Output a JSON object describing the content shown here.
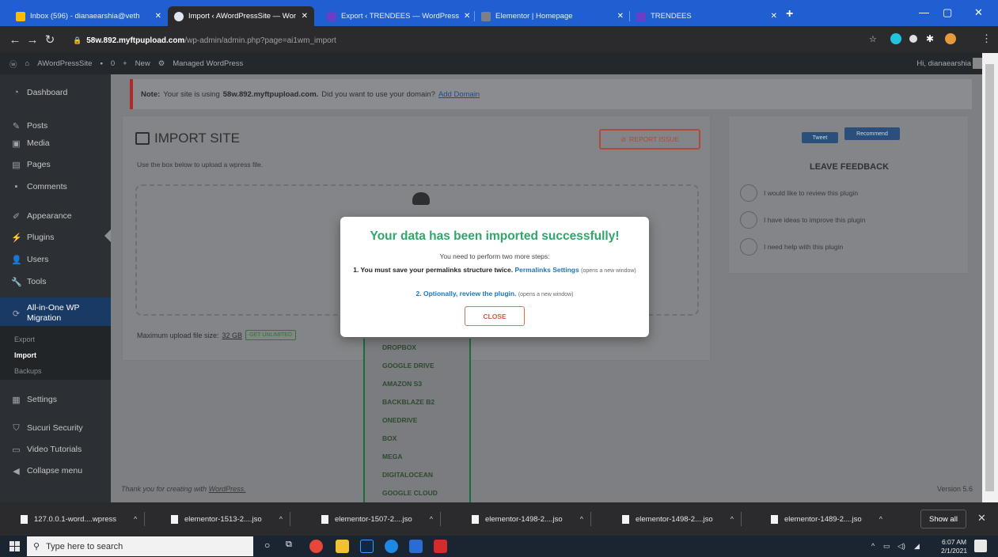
{
  "browser": {
    "tabs": [
      {
        "label": "Inbox (596) - dianaearshia@veth",
        "active": false
      },
      {
        "label": "Import ‹ AWordPressSite — Wor",
        "active": true
      },
      {
        "label": "Export ‹ TRENDEES — WordPress",
        "active": false
      },
      {
        "label": "Elementor | Homepage",
        "active": false
      },
      {
        "label": "TRENDEES",
        "active": false
      }
    ],
    "url_host": "58w.892.myftpupload.com",
    "url_path": "/wp-admin/admin.php?page=ai1wm_import"
  },
  "wp_admin_bar": {
    "site_name": "AWordPressSite",
    "comments_count": "0",
    "new_label": "New",
    "managed_label": "Managed WordPress",
    "greeting": "Hi, dianaearshia"
  },
  "sidebar": {
    "items": [
      {
        "label": "Dashboard",
        "icon": "dashboard-icon"
      },
      {
        "label": "Posts",
        "icon": "pin-icon"
      },
      {
        "label": "Media",
        "icon": "media-icon"
      },
      {
        "label": "Pages",
        "icon": "page-icon"
      },
      {
        "label": "Comments",
        "icon": "comment-icon"
      },
      {
        "label": "Appearance",
        "icon": "brush-icon"
      },
      {
        "label": "Plugins",
        "icon": "plug-icon"
      },
      {
        "label": "Users",
        "icon": "user-icon"
      },
      {
        "label": "Tools",
        "icon": "wrench-icon"
      },
      {
        "label": "All-in-One WP Migration",
        "icon": "migration-icon"
      },
      {
        "label": "Settings",
        "icon": "settings-icon"
      },
      {
        "label": "Sucuri Security",
        "icon": "shield-icon"
      },
      {
        "label": "Video Tutorials",
        "icon": "video-icon"
      },
      {
        "label": "Collapse menu",
        "icon": "collapse-icon"
      }
    ],
    "sub_items": [
      "Export",
      "Import",
      "Backups"
    ]
  },
  "notice": {
    "prefix": "Note:",
    "text": "Your site is using",
    "domain": "58w.892.myftpupload.com.",
    "question": "Did you want to use your domain?",
    "link": "Add Domain"
  },
  "import_panel": {
    "title": "IMPORT SITE",
    "report_label": "REPORT ISSUE",
    "description": "Use the box below to upload a wpress file.",
    "max_label": "Maximum upload file size:",
    "max_value": "32 GB",
    "unlimited_label": "GET UNLIMITED"
  },
  "storage_options": [
    "DROPBOX",
    "GOOGLE DRIVE",
    "AMAZON S3",
    "BACKBLAZE B2",
    "ONEDRIVE",
    "BOX",
    "MEGA",
    "DIGITALOCEAN",
    "GOOGLE CLOUD"
  ],
  "feedback": {
    "tweet_label": "Tweet",
    "recommend_label": "Recommend",
    "title": "LEAVE FEEDBACK",
    "options": [
      "I would like to review this plugin",
      "I have ideas to improve this plugin",
      "I need help with this plugin"
    ]
  },
  "footer": {
    "thanks_prefix": "Thank you for creating with",
    "thanks_link": "WordPress.",
    "version": "Version 5.6"
  },
  "modal": {
    "title": "Your data has been imported successfully!",
    "intro": "You need to perform two more steps:",
    "step1_text": "1. You must save your permalinks structure twice.",
    "step1_link": "Permalinks Settings",
    "step1_note": "(opens a new window)",
    "step2_prefix": "2.",
    "step2_link": "Optionally, review the plugin.",
    "step2_note": "(opens a new window)",
    "close_label": "CLOSE"
  },
  "downloads": [
    "127.0.0.1-word....wpress",
    "elementor-1513-2....jso",
    "elementor-1507-2....jso",
    "elementor-1498-2....jso",
    "elementor-1498-2....jso",
    "elementor-1489-2....jso"
  ],
  "downloads_show_all": "Show all",
  "taskbar": {
    "search_placeholder": "Type here to search",
    "time": "6:07 AM",
    "date": "2/1/2021"
  },
  "colors": {
    "browser_tab_bar": "#1f5fd1",
    "success_green": "#2fa66a",
    "close_orange": "#e36f4f",
    "link_blue": "#1d75bb"
  }
}
